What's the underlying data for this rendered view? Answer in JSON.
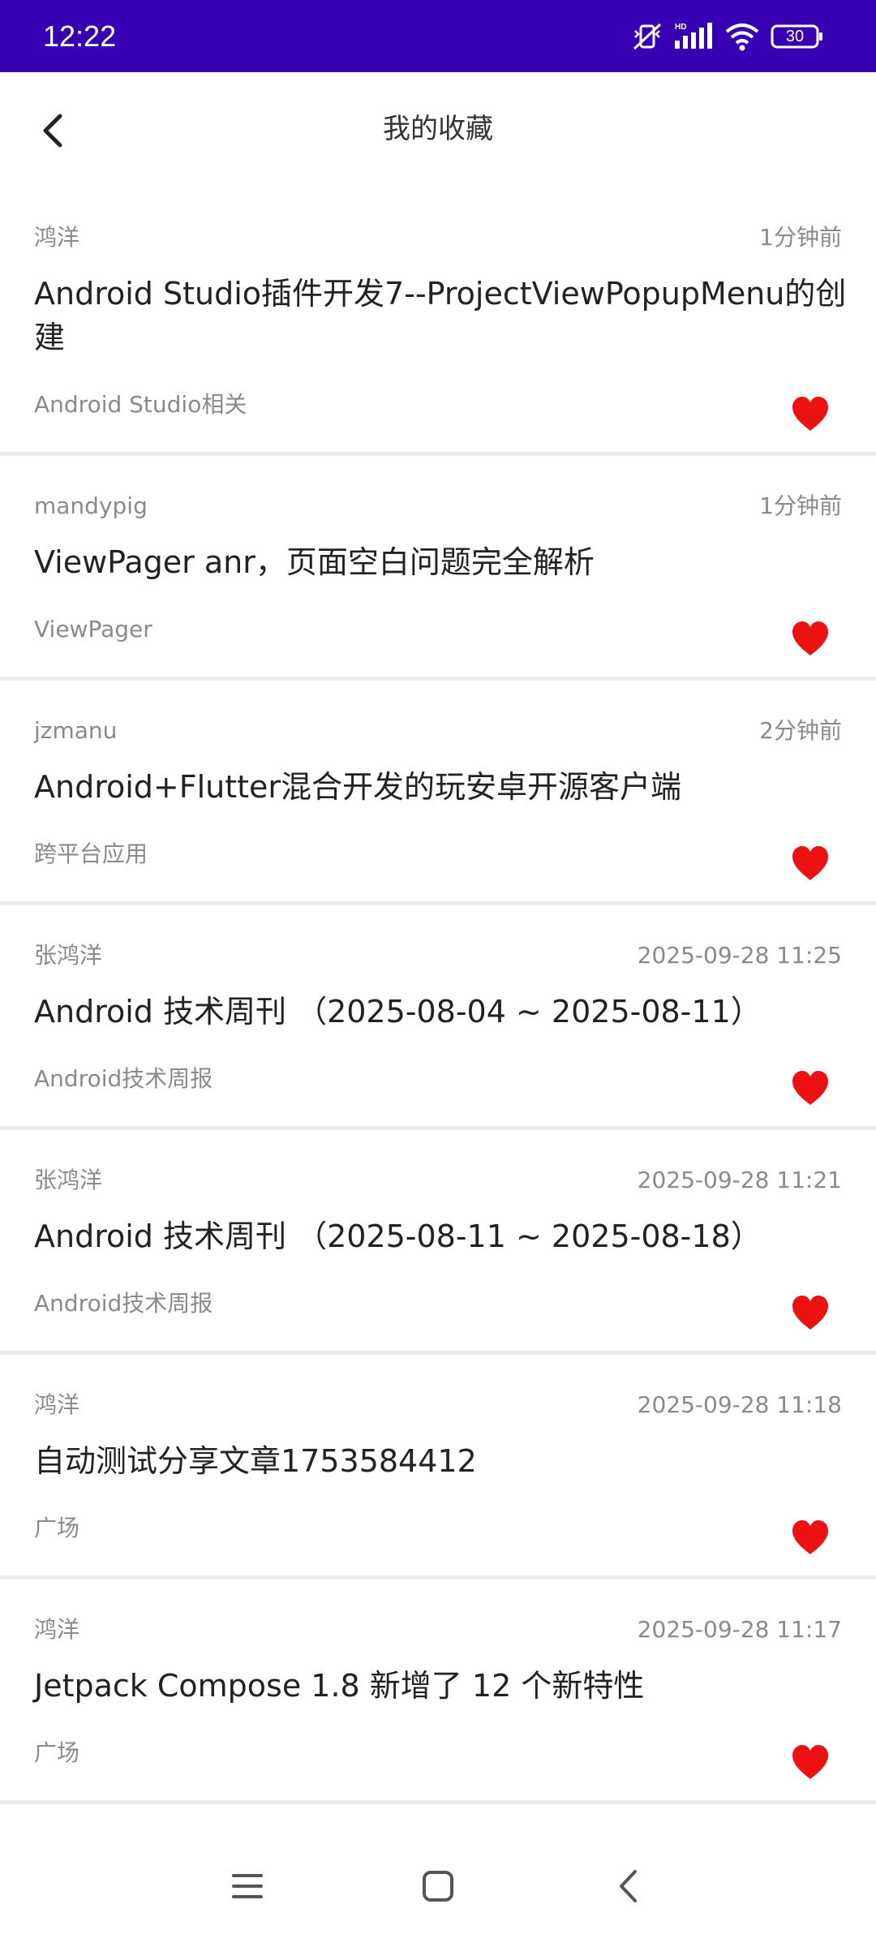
{
  "status_bar": {
    "time": "12:22",
    "battery_level": "30",
    "icons": [
      "mute-vibrate-icon",
      "hd-signal-icon",
      "wifi-icon",
      "battery-icon"
    ]
  },
  "app_bar": {
    "title": "我的收藏",
    "back_icon": "back-arrow-icon"
  },
  "colors": {
    "status_bar": "#3700B3",
    "heart": "#EE1111",
    "muted_text": "#8A8A8A",
    "title_text": "#222222"
  },
  "favorites": [
    {
      "author": "鸿洋",
      "time": "1分钟前",
      "title": "Android Studio插件开发7--ProjectViewPopupMenu的创建",
      "category": "Android Studio相关",
      "liked": true
    },
    {
      "author": "mandypig",
      "time": "1分钟前",
      "title": "ViewPager anr，页面空白问题完全解析",
      "category": "ViewPager",
      "liked": true
    },
    {
      "author": "jzmanu",
      "time": "2分钟前",
      "title": "Android+Flutter混合开发的玩安卓开源客户端",
      "category": "跨平台应用",
      "liked": true
    },
    {
      "author": "张鸿洋",
      "time": "2025-09-28 11:25",
      "title": "Android 技术周刊 （2025-08-04 ~ 2025-08-11）",
      "category": "Android技术周报",
      "liked": true
    },
    {
      "author": "张鸿洋",
      "time": "2025-09-28 11:21",
      "title": "Android 技术周刊 （2025-08-11 ~ 2025-08-18）",
      "category": "Android技术周报",
      "liked": true
    },
    {
      "author": "鸿洋",
      "time": "2025-09-28 11:18",
      "title": "自动测试分享文章1753584412",
      "category": "广场",
      "liked": true
    },
    {
      "author": "鸿洋",
      "time": "2025-09-28 11:17",
      "title": "Jetpack Compose 1.8 新增了 12 个新特性",
      "category": "广场",
      "liked": true
    }
  ],
  "nav_bar": {
    "icons": [
      "menu-icon",
      "home-icon",
      "back-icon"
    ]
  }
}
